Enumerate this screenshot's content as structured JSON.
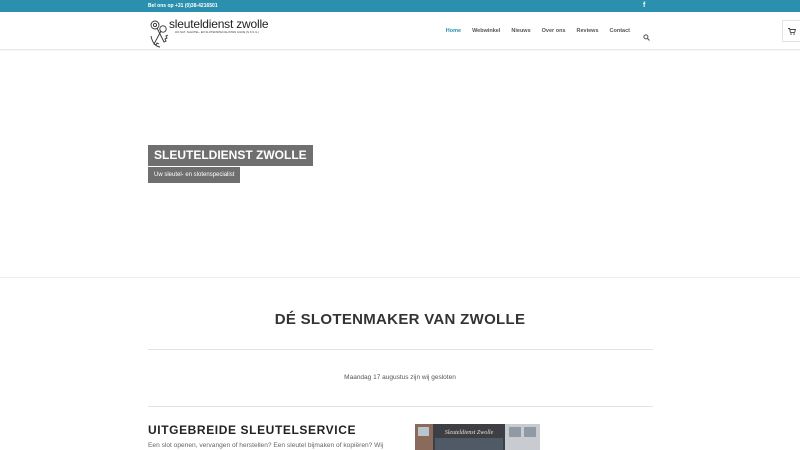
{
  "topbar": {
    "phone": "Bel ons op +31 (0)38-4216501",
    "facebook_glyph": "f"
  },
  "logo": {
    "title": "sleuteldienst zwolle",
    "subtitle": "LID NAT. SLEUTEL- EN SLOTENSPECIALISTEN GILDE  (N.S.S.G.)"
  },
  "nav": {
    "items": [
      {
        "label": "Home",
        "active": true
      },
      {
        "label": "Webwinkel",
        "active": false
      },
      {
        "label": "Nieuws",
        "active": false
      },
      {
        "label": "Over ons",
        "active": false
      },
      {
        "label": "Reviews",
        "active": false
      },
      {
        "label": "Contact",
        "active": false
      }
    ],
    "search_icon": "search-icon",
    "cart_icon": "shopping-cart-icon"
  },
  "hero": {
    "title": "SLEUTELDIENST ZWOLLE",
    "subtitle": "Uw sleutel- en slotenspecialist"
  },
  "main": {
    "heading": "DÉ SLOTENMAKER VAN ZWOLLE",
    "notice": "Maandag 17 augustus zijn wij gesloten",
    "service_title": "UITGEBREIDE SLEUTELSERVICE",
    "service_text": "Een slot openen, vervangen of herstellen? Een sleutel bijmaken of  kopiëren? Wij"
  },
  "photo": {
    "sign_text": "Sleuteldienst Zwolle"
  },
  "colors": {
    "accent": "#2b8fae",
    "hero_label_bg": "#6f6f6f",
    "nav_text": "#555555"
  }
}
